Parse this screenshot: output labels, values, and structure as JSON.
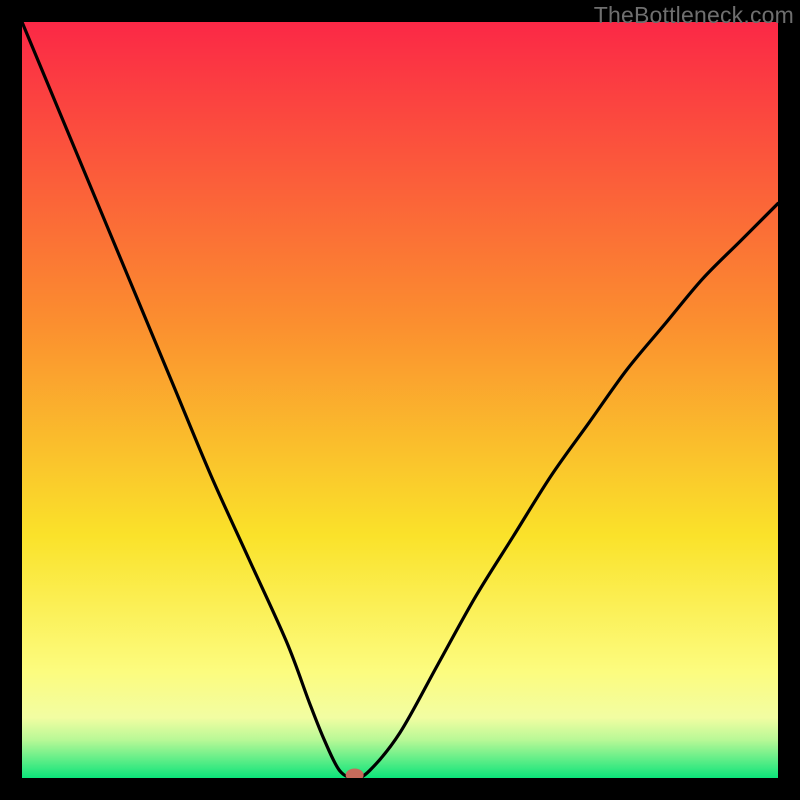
{
  "watermark": "TheBottleneck.com",
  "colors": {
    "gradient_top": "#fb2846",
    "gradient_mid1": "#fb8f2f",
    "gradient_mid2": "#fae22a",
    "gradient_mid3": "#fcfc7f",
    "gradient_bottom": "#0ce47a",
    "curve": "#000000",
    "marker": "#c66b5b",
    "frame_bg": "#000000"
  },
  "chart_data": {
    "type": "line",
    "title": "",
    "xlabel": "",
    "ylabel": "",
    "xlim": [
      0,
      100
    ],
    "ylim": [
      0,
      100
    ],
    "series": [
      {
        "name": "bottleneck-curve",
        "x": [
          0,
          5,
          10,
          15,
          20,
          25,
          30,
          35,
          38,
          40,
          42,
          44,
          46,
          50,
          55,
          60,
          65,
          70,
          75,
          80,
          85,
          90,
          95,
          100
        ],
        "y": [
          100,
          88,
          76,
          64,
          52,
          40,
          29,
          18,
          10,
          5,
          1,
          0,
          1,
          6,
          15,
          24,
          32,
          40,
          47,
          54,
          60,
          66,
          71,
          76
        ]
      }
    ],
    "marker": {
      "x": 44,
      "y": 0
    },
    "gradient_stops": [
      {
        "pos": 0.0,
        "color": "#fb2846"
      },
      {
        "pos": 0.4,
        "color": "#fb8f2f"
      },
      {
        "pos": 0.68,
        "color": "#fae22a"
      },
      {
        "pos": 0.86,
        "color": "#fcfc7f"
      },
      {
        "pos": 0.92,
        "color": "#f2fda2"
      },
      {
        "pos": 0.95,
        "color": "#b7f896"
      },
      {
        "pos": 1.0,
        "color": "#0ce47a"
      }
    ]
  }
}
